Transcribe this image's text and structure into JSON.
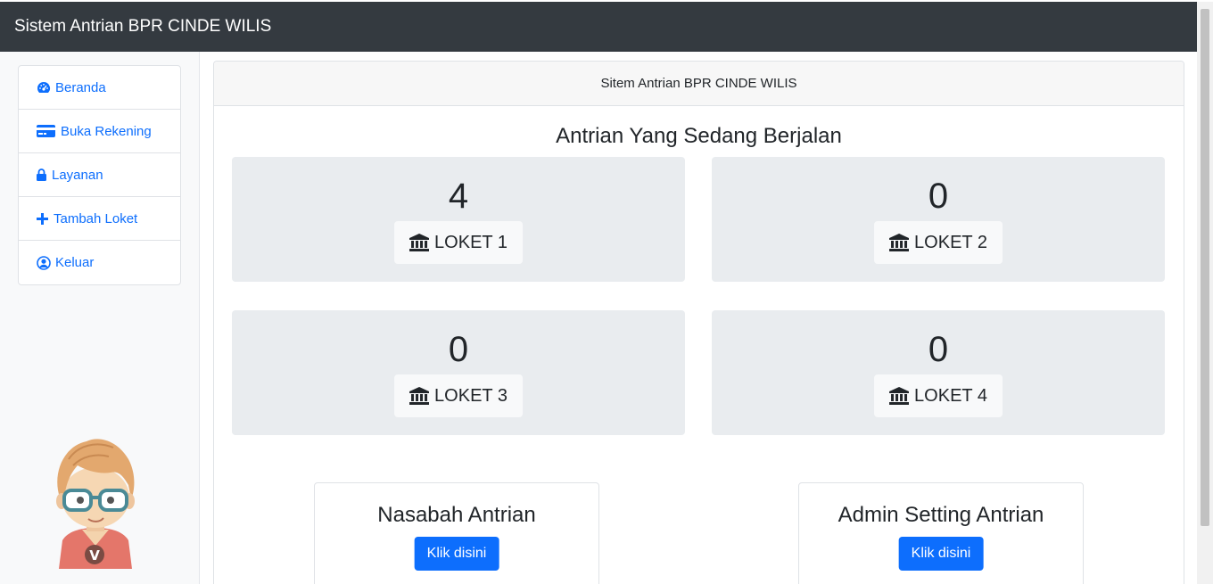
{
  "navbar": {
    "brand": "Sistem Antrian BPR CINDE WILIS"
  },
  "sidebar": {
    "items": [
      {
        "label": "Beranda",
        "icon": "dashboard-icon"
      },
      {
        "label": "Buka Rekening",
        "icon": "credit-card-icon"
      },
      {
        "label": "Layanan",
        "icon": "lock-icon"
      },
      {
        "label": "Tambah Loket",
        "icon": "plus-icon"
      },
      {
        "label": "Keluar",
        "icon": "user-circle-icon"
      }
    ]
  },
  "main": {
    "header": "Sitem Antrian BPR CINDE WILIS",
    "section_title": "Antrian Yang Sedang Berjalan",
    "lokets": [
      {
        "number": "4",
        "label": "LOKET 1",
        "icon": "bank-icon"
      },
      {
        "number": "0",
        "label": "LOKET 2",
        "icon": "bank-icon"
      },
      {
        "number": "0",
        "label": "LOKET 3",
        "icon": "bank-icon"
      },
      {
        "number": "0",
        "label": "LOKET 4",
        "icon": "bank-icon"
      }
    ],
    "boxes": [
      {
        "title": "Nasabah Antrian",
        "button": "Klik disini"
      },
      {
        "title": "Admin Setting Antrian",
        "button": "Klik disini"
      }
    ]
  },
  "colors": {
    "navbar": "#343a40",
    "link": "#0d6efd",
    "button": "#0d6efd",
    "panel": "#e9ecef"
  }
}
